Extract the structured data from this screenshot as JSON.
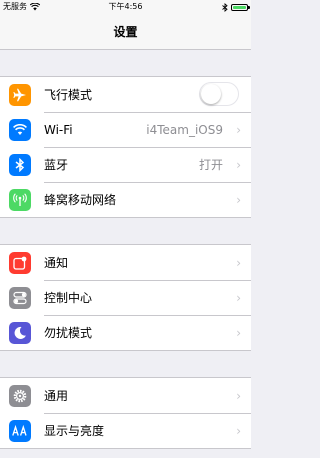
{
  "status_bar": {
    "carrier": "无服务",
    "time": "下午4:56"
  },
  "nav": {
    "title": "设置"
  },
  "groups": [
    [
      {
        "label": "飞行模式",
        "icon": "airplane-icon",
        "color": "#ff9500",
        "toggle": false
      },
      {
        "label": "Wi-Fi",
        "icon": "wifi-icon",
        "color": "#007aff",
        "value": "i4Team_iOS9"
      },
      {
        "label": "蓝牙",
        "icon": "bluetooth-icon",
        "color": "#007aff",
        "value": "打开"
      },
      {
        "label": "蜂窝移动网络",
        "icon": "cellular-icon",
        "color": "#4cd964"
      }
    ],
    [
      {
        "label": "通知",
        "icon": "notifications-icon",
        "color": "#ff3b30"
      },
      {
        "label": "控制中心",
        "icon": "control-center-icon",
        "color": "#8e8e93"
      },
      {
        "label": "勿扰模式",
        "icon": "moon-icon",
        "color": "#5856d6"
      }
    ],
    [
      {
        "label": "通用",
        "icon": "gear-icon",
        "color": "#8e8e93"
      },
      {
        "label": "显示与亮度",
        "icon": "display-icon",
        "color": "#007aff"
      }
    ]
  ],
  "chevron": "›"
}
